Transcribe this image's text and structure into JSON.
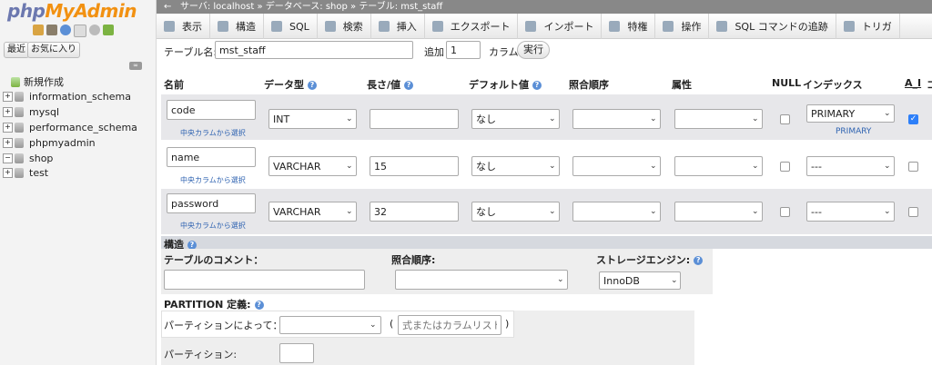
{
  "sidebar": {
    "logo_php": "php",
    "logo_myadmin": "MyAdmin",
    "btn_recent": "最近",
    "btn_favorites": "お気に入り",
    "new_item": "新規作成",
    "databases": [
      "information_schema",
      "mysql",
      "performance_schema",
      "phpmyadmin",
      "shop",
      "test"
    ]
  },
  "breadcrumb": {
    "server": "サーバ: localhost",
    "database": "データベース: shop",
    "table": "テーブル: mst_staff"
  },
  "tabs": [
    "表示",
    "構造",
    "SQL",
    "検索",
    "挿入",
    "エクスポート",
    "インポート",
    "特権",
    "操作",
    "SQL コマンドの追跡",
    "トリガ"
  ],
  "form": {
    "table_name_label": "テーブル名:",
    "table_name": "mst_staff",
    "add_label": "追加",
    "add_count": "1",
    "column_label": "カラム",
    "run_button": "実行"
  },
  "columns_header": {
    "name": "名前",
    "type": "データ型",
    "length": "長さ/値",
    "default": "デフォルト値",
    "collation": "照合順序",
    "attributes": "属性",
    "null": "NULL",
    "index": "インデックス",
    "ai": "A_I",
    "comment": "コ"
  },
  "rows": [
    {
      "name": "code",
      "type": "INT",
      "length": "",
      "default": "なし",
      "index": "PRIMARY",
      "index_sub": "PRIMARY",
      "ai": true,
      "pick": "中央カラムから選択"
    },
    {
      "name": "name",
      "type": "VARCHAR",
      "length": "15",
      "default": "なし",
      "index": "---",
      "index_sub": "",
      "ai": false,
      "pick": "中央カラムから選択"
    },
    {
      "name": "password",
      "type": "VARCHAR",
      "length": "32",
      "default": "なし",
      "index": "---",
      "index_sub": "",
      "ai": false,
      "pick": "中央カラムから選択"
    }
  ],
  "structure": {
    "label": "構造",
    "comment_label": "テーブルのコメント：",
    "collation_label": "照合順序:",
    "engine_label": "ストレージエンジン:",
    "engine": "InnoDB"
  },
  "partition": {
    "label": "PARTITION 定義:",
    "by_label": "パーティションによって：",
    "expr_placeholder": "式またはカラムリスト",
    "open_paren": "(",
    "close_paren": ")",
    "partitions_label": "パーティション:"
  },
  "colors": {
    "accent": "#2d7ff9",
    "sidebar_bg": "#f3f3f3",
    "breadcrumb_bg": "#888888"
  }
}
